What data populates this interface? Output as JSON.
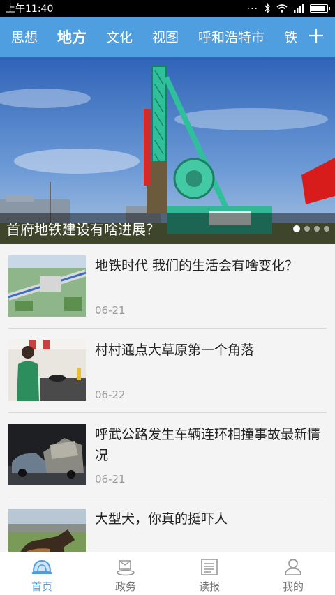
{
  "status_bar": {
    "time": "上午11:40",
    "dots": "...",
    "battery_level": 0.9
  },
  "top_nav": {
    "tabs": [
      {
        "label": "思想",
        "active": false
      },
      {
        "label": "地方",
        "active": true
      },
      {
        "label": "文化",
        "active": false
      },
      {
        "label": "视图",
        "active": false
      },
      {
        "label": "呼和浩特市",
        "active": false
      },
      {
        "label": "铁",
        "active": false
      }
    ],
    "accent_color": "#4f9ee0"
  },
  "banner": {
    "title": "首府地铁建设有啥进展？",
    "slide_count": 4,
    "active_slide": 1
  },
  "news": [
    {
      "title": "地铁时代 我们的生活会有啥变化？",
      "date": "06-21",
      "thumb": "subway-map-photo"
    },
    {
      "title": "村村通点大草原第一个角落",
      "date": "06-22",
      "thumb": "kitchen-woman-photo"
    },
    {
      "title": "呼武公路发生车辆连环相撞事故最新情况",
      "date": "06-21",
      "thumb": "car-accident-photo"
    },
    {
      "title": "大型犬，你真的挺吓人",
      "date": "",
      "thumb": "dog-photo"
    }
  ],
  "bottom_nav": [
    {
      "label": "首页",
      "icon": "home-dome-icon",
      "active": true
    },
    {
      "label": "政务",
      "icon": "government-icon",
      "active": false
    },
    {
      "label": "读报",
      "icon": "newspaper-icon",
      "active": false
    },
    {
      "label": "我的",
      "icon": "profile-icon",
      "active": false
    }
  ]
}
